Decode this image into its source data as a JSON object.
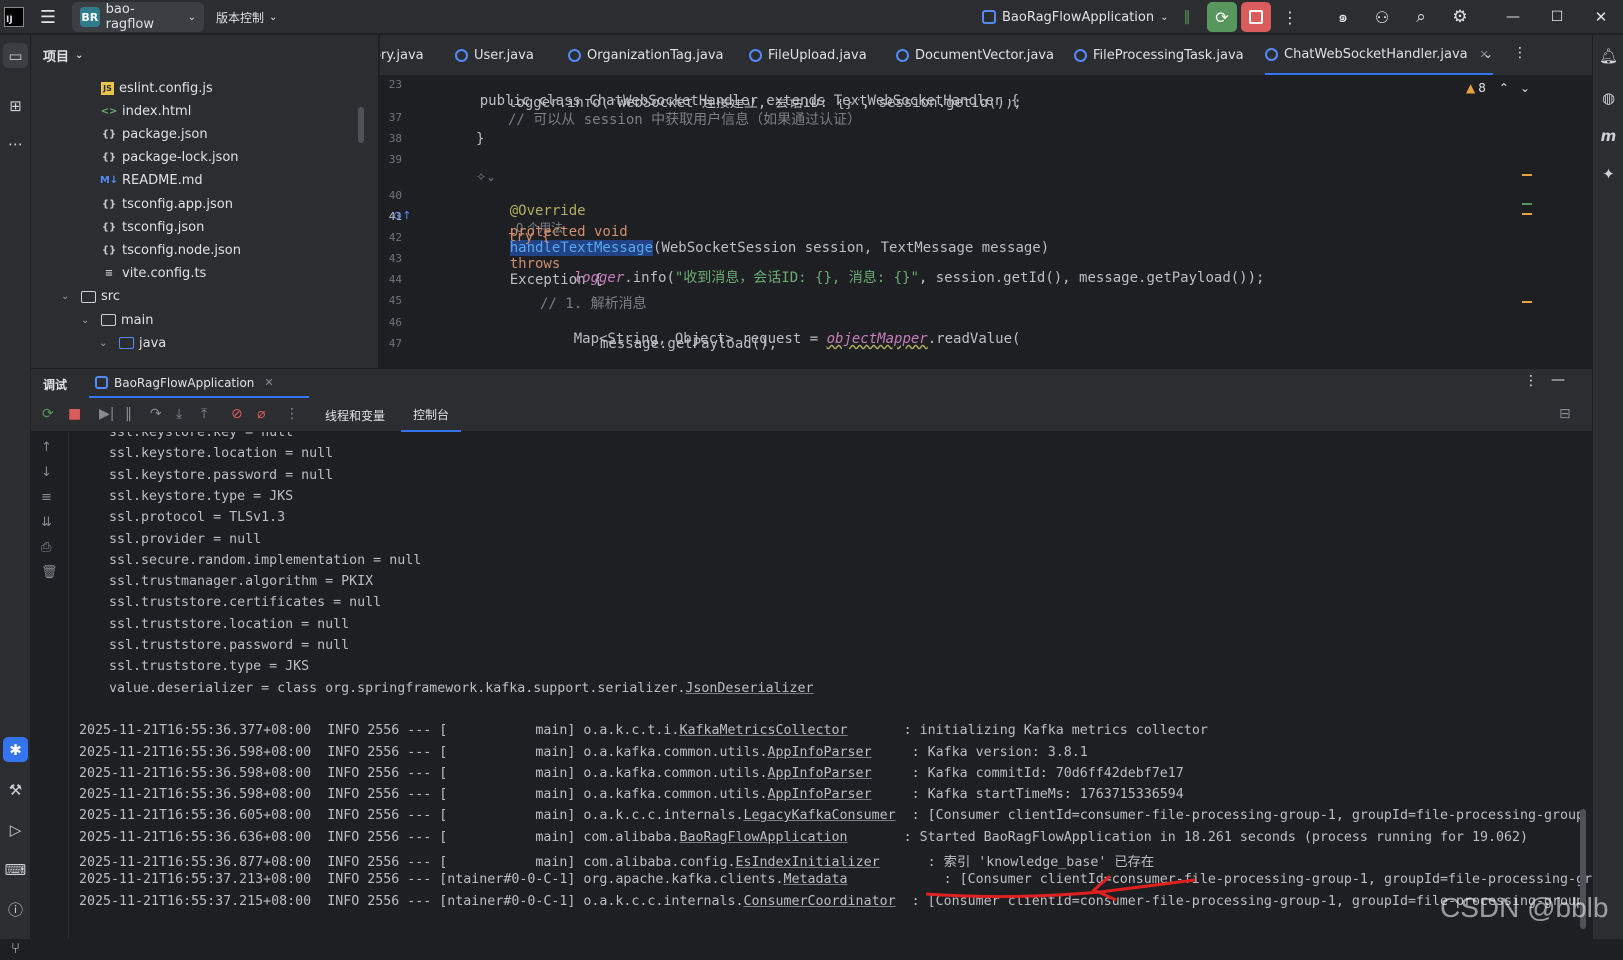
{
  "titlebar": {
    "project_badge": "BR",
    "project_name": "bao-ragflow",
    "vcs_label": "版本控制",
    "run_config": "BaoRagFlowApplication"
  },
  "project_panel": {
    "title": "项目",
    "items": [
      {
        "icon": "JS",
        "label": "eslint.config.js"
      },
      {
        "icon": "<>",
        "label": "index.html"
      },
      {
        "icon": "{}",
        "label": "package.json"
      },
      {
        "icon": "{}",
        "label": "package-lock.json"
      },
      {
        "icon": "M↓",
        "label": "README.md"
      },
      {
        "icon": "{}",
        "label": "tsconfig.app.json"
      },
      {
        "icon": "{}",
        "label": "tsconfig.json"
      },
      {
        "icon": "{}",
        "label": "tsconfig.node.json"
      },
      {
        "icon": "≡",
        "label": "vite.config.ts"
      },
      {
        "icon": "folder",
        "label": "src"
      },
      {
        "icon": "folder",
        "label": "main"
      },
      {
        "icon": "folder",
        "label": "java"
      }
    ]
  },
  "editor": {
    "tabs": [
      "tory.java",
      "User.java",
      "OrganizationTag.java",
      "FileUpload.java",
      "DocumentVector.java",
      "FileProcessingTask.java",
      "ChatWebSocketHandler.java"
    ],
    "warnings_count": "8",
    "usages_hint": "0 个用法",
    "line_numbers": [
      "23",
      "37",
      "38",
      "39",
      "40",
      "41",
      "42",
      "43",
      "44",
      "45",
      "46",
      "47"
    ],
    "sticky_line": "public class ChatWebSocketHandler extends TextWebSocketHandler {",
    "line_36_fragment": "logger.info(\"WebSocket 连接建立, 会话ID: {}\", session.getId());",
    "line_37": "// 可以从 session 中获取用户信息（如果通过认证）",
    "line_38": "}",
    "line_40": "@Override",
    "line_41_kw": "protected void",
    "line_41_fn": "handleTextMessage",
    "line_41_params": "(WebSocketSession session, TextMessage message)",
    "line_41_throws": "throws",
    "line_41_rest": "Exception {",
    "line_42": "try {",
    "line_43_logger": "logger",
    "line_43_call": ".info(",
    "line_43_str": "\"收到消息，会话ID: {}, 消息: {}\"",
    "line_43_rest": ", session.getId(), message.getPayload());",
    "line_45": "// 1. 解析消息",
    "line_46_a": "Map<String, Object> request = ",
    "line_46_b": "objectMapper",
    "line_46_c": ".readValue(",
    "line_47": "message.getPayload(),"
  },
  "debug": {
    "title": "调试",
    "session_tab": "BaoRagFlowApplication",
    "tab_threads": "线程和变量",
    "tab_console": "控制台"
  },
  "console": {
    "config_lines": [
      "ssl.keystore.key = null",
      "ssl.keystore.location = null",
      "ssl.keystore.password = null",
      "ssl.keystore.type = JKS",
      "ssl.protocol = TLSv1.3",
      "ssl.provider = null",
      "ssl.secure.random.implementation = null",
      "ssl.trustmanager.algorithm = PKIX",
      "ssl.truststore.certificates = null",
      "ssl.truststore.location = null",
      "ssl.truststore.password = null",
      "ssl.truststore.type = JKS"
    ],
    "deserializer_prefix": "value.deserializer = class org.springframework.kafka.support.serializer.",
    "deserializer_class": "JsonDeserializer",
    "log_lines": [
      {
        "ts": "2025-11-21T16:55:36.377+08:00",
        "lvl": "INFO 2556 --- [",
        "thread": "           main] ",
        "pkg": "o.a.k.c.t.i.",
        "cls": "KafkaMetricsCollector",
        "pad": "       ",
        "msg": ": initializing Kafka metrics collector"
      },
      {
        "ts": "2025-11-21T16:55:36.598+08:00",
        "lvl": "INFO 2556 --- [",
        "thread": "           main] ",
        "pkg": "o.a.kafka.common.utils.",
        "cls": "AppInfoParser",
        "pad": "     ",
        "msg": ": Kafka version: 3.8.1"
      },
      {
        "ts": "2025-11-21T16:55:36.598+08:00",
        "lvl": "INFO 2556 --- [",
        "thread": "           main] ",
        "pkg": "o.a.kafka.common.utils.",
        "cls": "AppInfoParser",
        "pad": "     ",
        "msg": ": Kafka commitId: 70d6ff42debf7e17"
      },
      {
        "ts": "2025-11-21T16:55:36.598+08:00",
        "lvl": "INFO 2556 --- [",
        "thread": "           main] ",
        "pkg": "o.a.kafka.common.utils.",
        "cls": "AppInfoParser",
        "pad": "     ",
        "msg": ": Kafka startTimeMs: 1763715336594"
      },
      {
        "ts": "2025-11-21T16:55:36.605+08:00",
        "lvl": "INFO 2556 --- [",
        "thread": "           main] ",
        "pkg": "o.a.k.c.c.internals.",
        "cls": "LegacyKafkaConsumer",
        "pad": "  ",
        "msg": ": [Consumer clientId=consumer-file-processing-group-1, groupId=file-processing-group"
      },
      {
        "ts": "2025-11-21T16:55:36.636+08:00",
        "lvl": "INFO 2556 --- [",
        "thread": "           main] ",
        "pkg": "com.alibaba.",
        "cls": "BaoRagFlowApplication",
        "pad": "       ",
        "msg": ": Started BaoRagFlowApplication in 18.261 seconds (process running for 19.062)"
      },
      {
        "ts": "2025-11-21T16:55:36.877+08:00",
        "lvl": "INFO 2556 --- [",
        "thread": "           main] ",
        "pkg": "com.alibaba.config.",
        "cls": "EsIndexInitializer",
        "pad": "      ",
        "msg": ": 索引 'knowledge_base' 已存在"
      },
      {
        "ts": "2025-11-21T16:55:37.213+08:00",
        "lvl": "INFO 2556 --- [",
        "thread": "ntainer#0-0-C-1] ",
        "pkg": "org.apache.kafka.clients.",
        "cls": "Metadata",
        "pad": "            ",
        "msg": ": [Consumer clientId=consumer-file-processing-group-1, groupId=file-processing-group"
      },
      {
        "ts": "2025-11-21T16:55:37.215+08:00",
        "lvl": "INFO 2556 --- [",
        "thread": "ntainer#0-0-C-1] ",
        "pkg": "o.a.k.c.c.internals.",
        "cls": "ConsumerCoordinator",
        "pad": "  ",
        "msg": ": [Consumer clientId=consumer-file-processing-group-1, groupId=file-processing-group"
      }
    ]
  },
  "watermark": "CSDN @bblb",
  "colors": {
    "accent": "#3574f0",
    "run_green": "#57965c",
    "stop_red": "#db5c5c",
    "annotation_arrow": "#e02020"
  }
}
